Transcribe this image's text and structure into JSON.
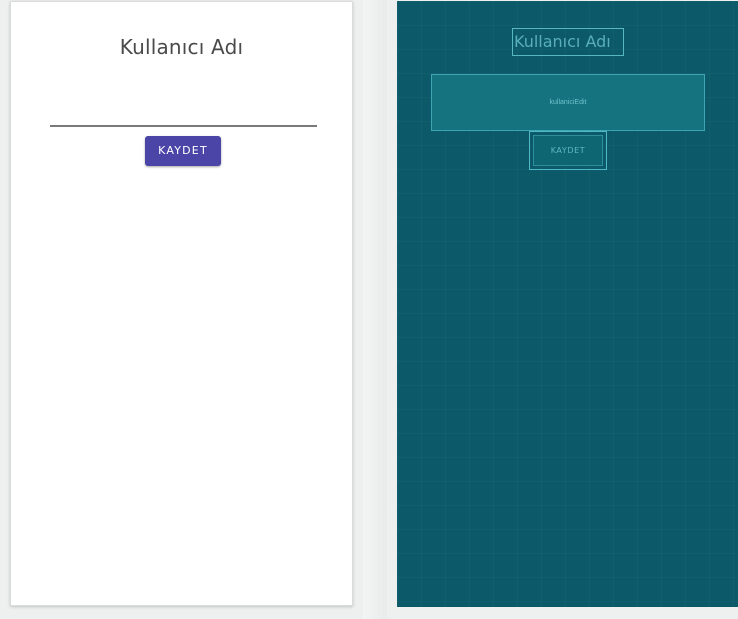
{
  "design": {
    "title": "Kullanıcı Adı",
    "edit_text_value": "",
    "button_label": "KAYDET",
    "colors": {
      "background": "#ffffff",
      "button": "#4b45a7",
      "button_text": "#ffffff",
      "title_text": "#4a4a4a"
    }
  },
  "blueprint": {
    "title_label": "Kullanıcı Adı",
    "edit_text_id": "kullaniciEdit",
    "button_label": "KAYDET",
    "colors": {
      "background": "#0c5a69",
      "outline": "#57b8c4",
      "text": "#59aebb"
    }
  }
}
